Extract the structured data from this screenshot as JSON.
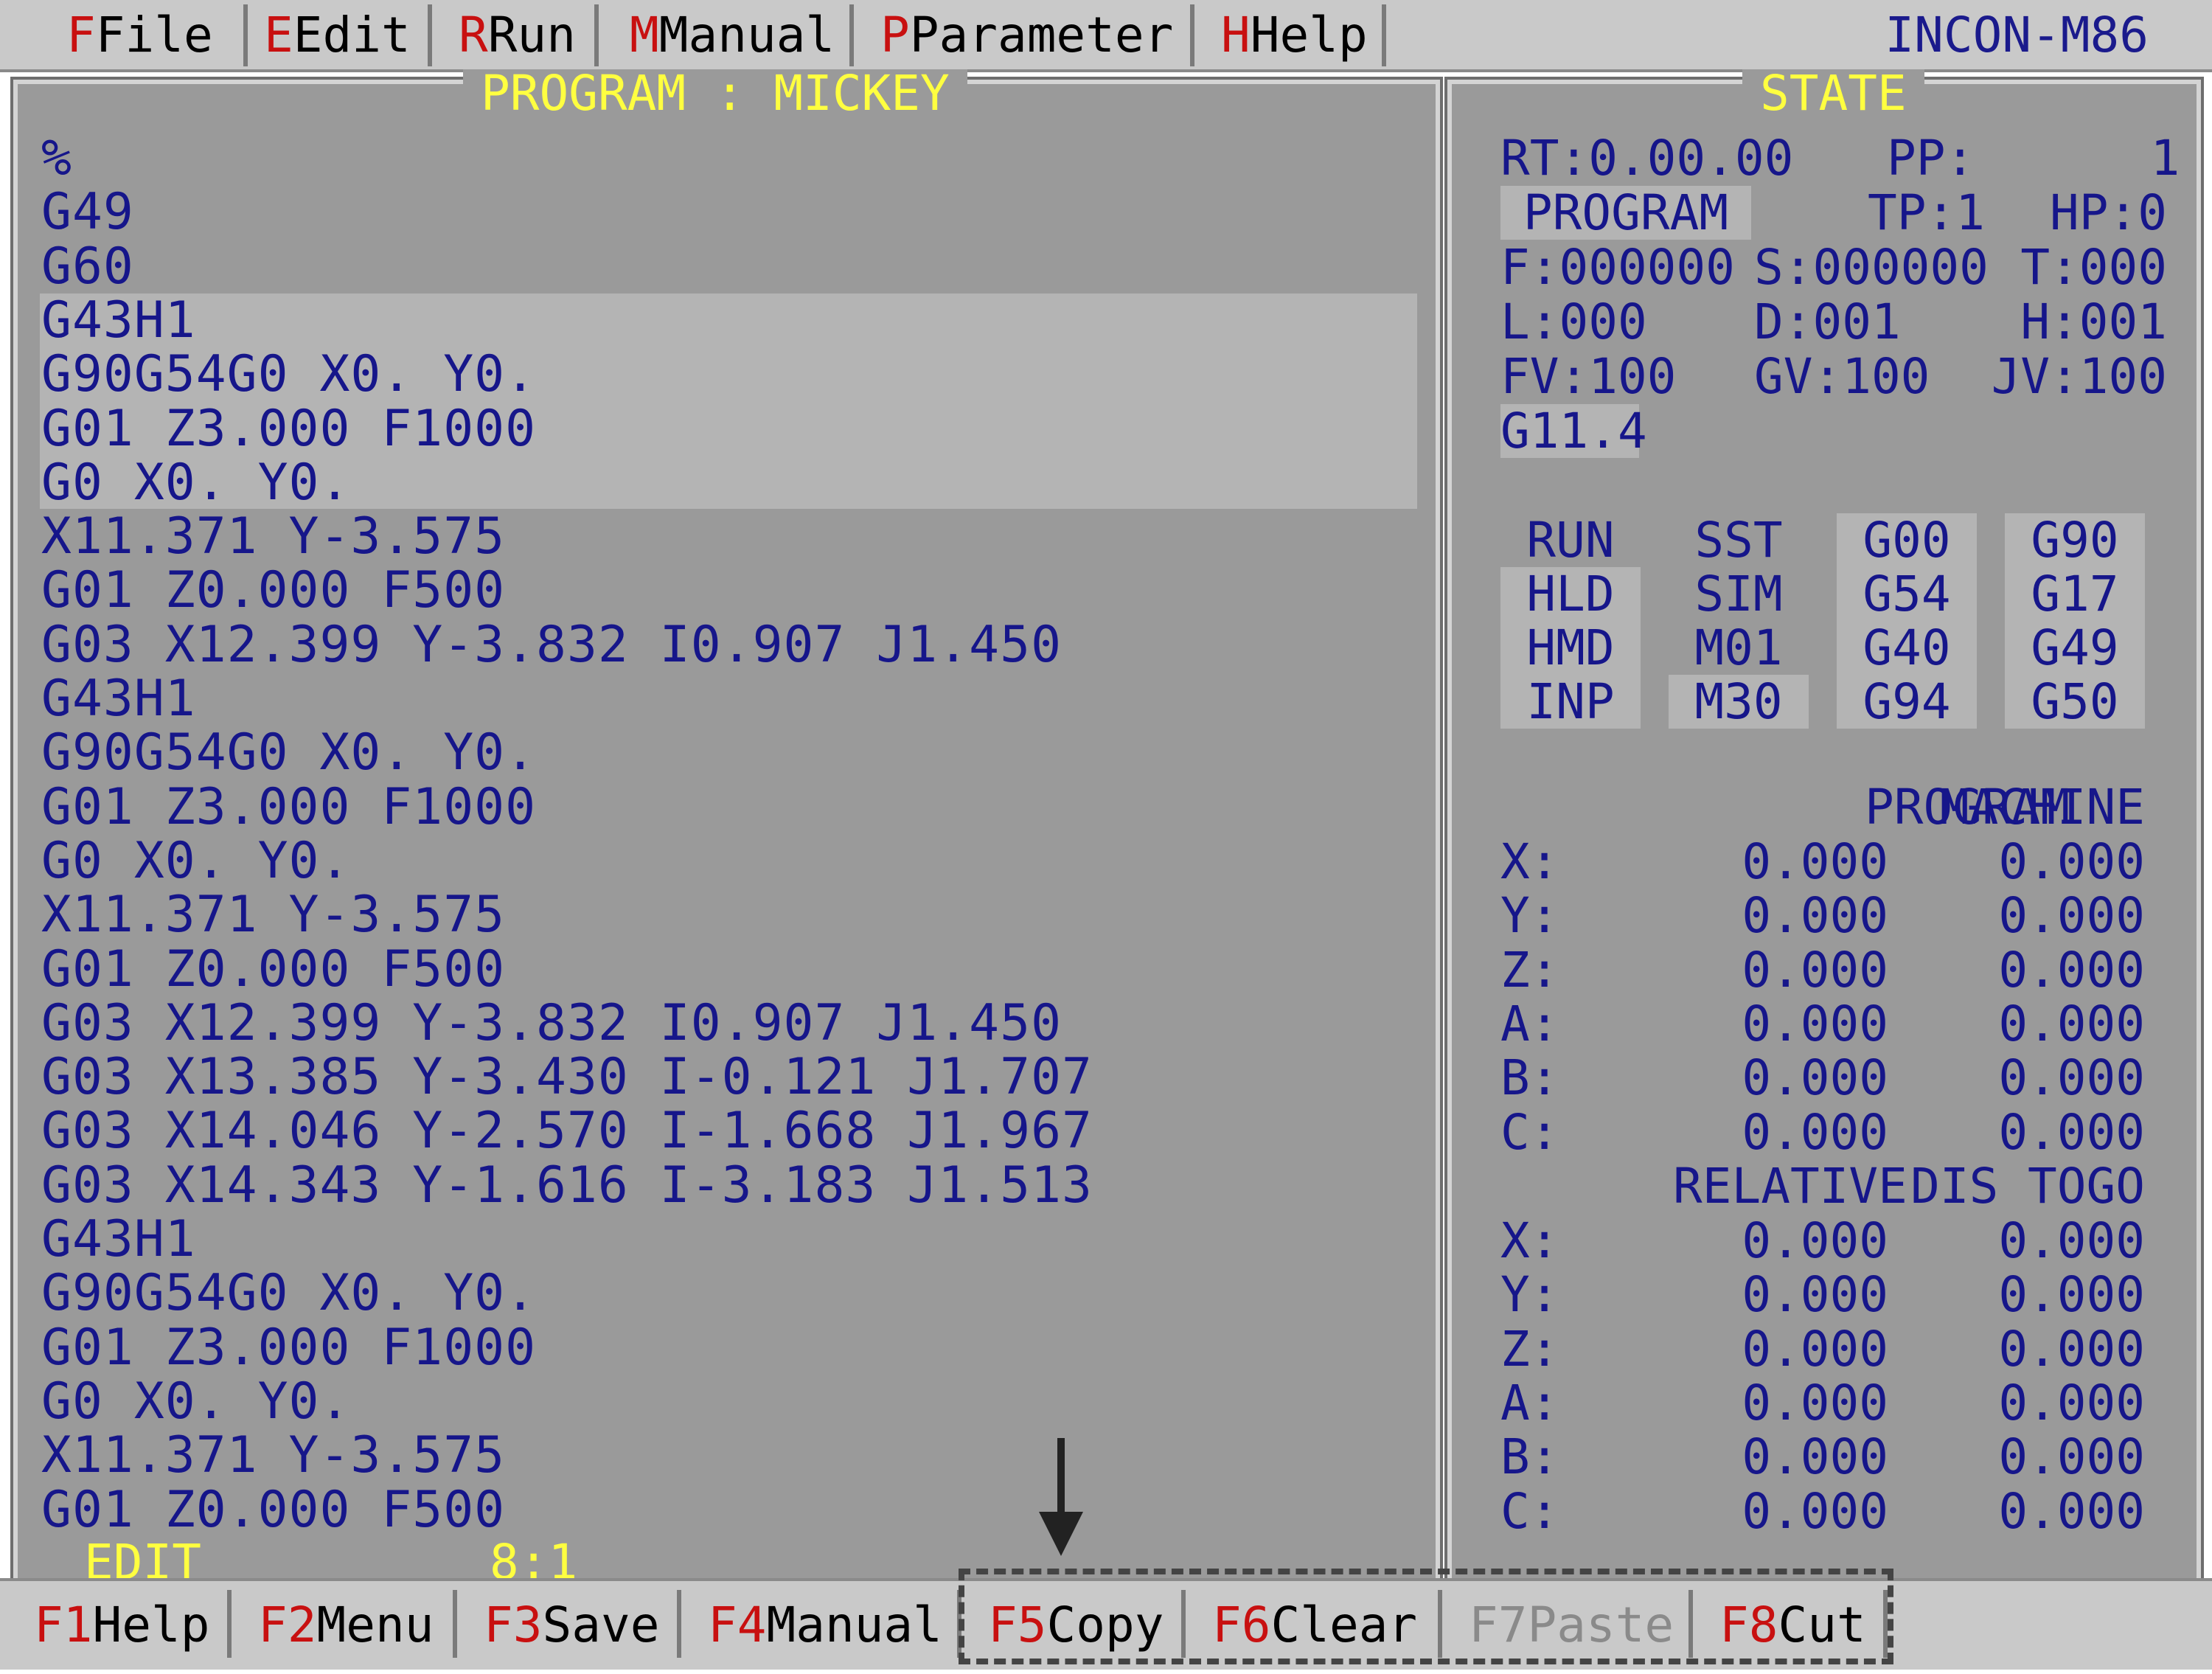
{
  "menu": {
    "items": [
      {
        "hotkey": "F",
        "label": "File"
      },
      {
        "hotkey": "E",
        "label": "Edit"
      },
      {
        "hotkey": "R",
        "label": "Run"
      },
      {
        "hotkey": "M",
        "label": "Manual"
      },
      {
        "hotkey": "P",
        "label": "Parameter"
      },
      {
        "hotkey": "H",
        "label": "Help"
      }
    ],
    "app_title": "INCON-M86"
  },
  "program": {
    "title": "PROGRAM : MICKEY",
    "lines": [
      "%",
      "G49",
      "G60",
      "G43H1",
      "G90G54G0 X0. Y0.",
      "G01 Z3.000 F1000",
      "G0 X0. Y0.",
      "X11.371 Y-3.575",
      "G01 Z0.000 F500",
      "G03 X12.399 Y-3.832 I0.907 J1.450",
      "G43H1",
      "G90G54G0 X0. Y0.",
      "G01 Z3.000 F1000",
      "G0 X0. Y0.",
      "X11.371 Y-3.575",
      "G01 Z0.000 F500",
      "G03 X12.399 Y-3.832 I0.907 J1.450",
      "G03 X13.385 Y-3.430 I-0.121 J1.707",
      "G03 X14.046 Y-2.570 I-1.668 J1.967",
      "G03 X14.343 Y-1.616 I-3.183 J1.513",
      "G43H1",
      "G90G54G0 X0. Y0.",
      "G01 Z3.000 F1000",
      "G0 X0. Y0.",
      "X11.371 Y-3.575",
      "G01 Z0.000 F500"
    ],
    "mode": "EDIT",
    "cursor_pos": "8:1"
  },
  "state": {
    "title": "STATE",
    "rt": "RT:0.00.00",
    "pp": "PP:      1",
    "mode_box": "PROGRAM",
    "tp": "TP:1",
    "hp": "HP:0",
    "f": "F:000000",
    "s": "S:000000",
    "t": "T:000",
    "l": "L:000",
    "d": "D:001",
    "h": "H:001",
    "fv": "FV:100",
    "gv": "GV:100",
    "jv": "JV:100",
    "g_code": "G11.4",
    "flags": [
      [
        "RUN",
        "SST",
        "G00",
        "G90"
      ],
      [
        "HLD",
        "SIM",
        "G54",
        "G17"
      ],
      [
        "HMD",
        "M01",
        "G40",
        "G49"
      ],
      [
        "INP",
        "M30",
        "G94",
        "G50"
      ]
    ],
    "coord_headers_1": [
      "PROGRAM",
      "MACHINE"
    ],
    "coord_headers_2": [
      "RELATIVE",
      "DIS TOGO"
    ],
    "axes": [
      "X:",
      "Y:",
      "Z:",
      "A:",
      "B:",
      "C:"
    ],
    "program_vals": [
      "0.000",
      "0.000",
      "0.000",
      "0.000",
      "0.000",
      "0.000"
    ],
    "machine_vals": [
      "0.000",
      "0.000",
      "0.000",
      "0.000",
      "0.000",
      "0.000"
    ],
    "relative_vals": [
      "0.000",
      "0.000",
      "0.000",
      "0.000",
      "0.000",
      "0.000"
    ],
    "distogo_vals": [
      "0.000",
      "0.000",
      "0.000",
      "0.000",
      "0.000",
      "0.000"
    ]
  },
  "fkeys": [
    {
      "num": "F1",
      "label": "Help",
      "enabled": true
    },
    {
      "num": "F2",
      "label": "Menu",
      "enabled": true
    },
    {
      "num": "F3",
      "label": "Save",
      "enabled": true
    },
    {
      "num": "F4",
      "label": "Manual",
      "enabled": true
    },
    {
      "num": "F5",
      "label": "Copy",
      "enabled": true
    },
    {
      "num": "F6",
      "label": "Clear",
      "enabled": true
    },
    {
      "num": "F7",
      "label": "Paste",
      "enabled": false
    },
    {
      "num": "F8",
      "label": "Cut",
      "enabled": true
    }
  ]
}
